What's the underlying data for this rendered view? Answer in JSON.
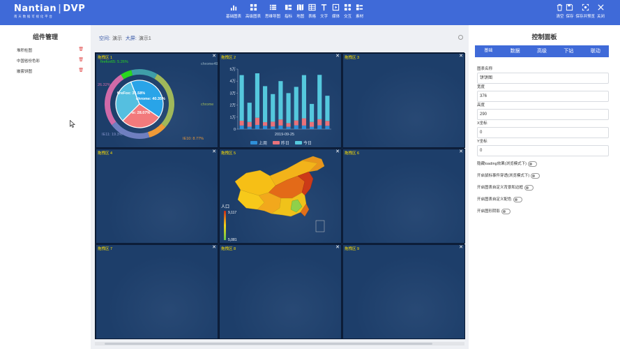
{
  "app": {
    "logo_main": "Nantian",
    "logo_sep": "|",
    "logo_product": "DVP",
    "logo_sub": "南天数据可视化平台"
  },
  "toolbar": {
    "items": [
      {
        "label": "基础图表",
        "icon": "bar-chart-icon"
      },
      {
        "label": "高级图表",
        "icon": "grid-chart-icon"
      },
      {
        "label": "思维导图",
        "icon": "list-icon"
      },
      {
        "label": "指标",
        "icon": "indicator-icon"
      },
      {
        "label": "地图",
        "icon": "map-icon"
      },
      {
        "label": "表格",
        "icon": "table-icon"
      },
      {
        "label": "文字",
        "icon": "text-icon"
      },
      {
        "label": "媒体",
        "icon": "media-icon"
      },
      {
        "label": "交互",
        "icon": "interaction-icon"
      },
      {
        "label": "素材",
        "icon": "material-icon"
      }
    ],
    "right": [
      {
        "label": "清空",
        "icon": "trash-icon"
      },
      {
        "label": "保存",
        "icon": "save-icon"
      },
      {
        "label": "保存并预览",
        "icon": "preview-icon"
      },
      {
        "label": "关闭",
        "icon": "close-icon"
      }
    ]
  },
  "left": {
    "title": "组件管理",
    "items": [
      {
        "label": "堆积柱图"
      },
      {
        "label": "中国省份色彩"
      },
      {
        "label": "嵌套饼图"
      }
    ]
  },
  "breadcrumb": {
    "space_label": "空间:",
    "space_value": "演示",
    "screen_label": "大屏:",
    "screen_value": "演示1"
  },
  "cells": [
    {
      "label": "拖拽区 1"
    },
    {
      "label": "拖拽区 2"
    },
    {
      "label": "拖拽区 3"
    },
    {
      "label": "拖拽区 4"
    },
    {
      "label": "拖拽区 5"
    },
    {
      "label": "拖拽区 6"
    },
    {
      "label": "拖拽区 7"
    },
    {
      "label": "拖拽区 8"
    },
    {
      "label": "拖拽区 9"
    }
  ],
  "close_glyph": "✕",
  "pie": {
    "inner": [
      {
        "label": "fireFox: 31.58%",
        "value": 31.58,
        "color": "#55bfe0"
      },
      {
        "label": "chrome: 40.35%",
        "value": 40.35,
        "color": "#29a4e8"
      },
      {
        "label": "ie: 28.07%",
        "value": 28.07,
        "color": "#f27a7c"
      }
    ],
    "outer": [
      {
        "label": "firefox65: 5.26%",
        "value": 5.26,
        "color": "#29d61f"
      },
      {
        "label": "chrome49: 12.28%",
        "value": 12.28,
        "color": "#3f9ea8"
      },
      {
        "label": "chrome",
        "value": 28.07,
        "color": "#a0b85a"
      },
      {
        "label": "IE10: 8.77%",
        "value": 8.77,
        "color": "#ef9a37"
      },
      {
        "label": "IE11: 19.3%",
        "value": 19.3,
        "color": "#6f7fc0"
      },
      {
        "label": "26.32%",
        "value": 26.32,
        "color": "#d06aa8"
      }
    ],
    "colors": {
      "inner_stroke": "#ffffff"
    }
  },
  "chart_data": {
    "type": "bar",
    "title": "",
    "xlabel": "2019-09-25",
    "ylabel": "",
    "ylim": [
      0,
      50000
    ],
    "y_ticks": [
      "0",
      "1万",
      "2万",
      "3万",
      "4万",
      "5万"
    ],
    "categories": [
      "1",
      "2",
      "3",
      "4",
      "5",
      "6",
      "7",
      "8",
      "9",
      "10",
      "11",
      "12"
    ],
    "stacked": true,
    "series": [
      {
        "name": "上周",
        "color": "#2f8fd8",
        "values": [
          3000,
          2000,
          3500,
          2800,
          2200,
          3000,
          2000,
          3200,
          3000,
          2000,
          3200,
          2800
        ]
      },
      {
        "name": "昨日",
        "color": "#e9727a",
        "values": [
          4000,
          4000,
          6000,
          3000,
          4000,
          5000,
          3000,
          4000,
          6000,
          4000,
          5000,
          4000
        ]
      },
      {
        "name": "今日",
        "color": "#55c8dd",
        "values": [
          38000,
          16000,
          37000,
          30000,
          23000,
          32000,
          25000,
          28000,
          36000,
          15000,
          37000,
          21000
        ]
      }
    ]
  },
  "map": {
    "legend_title": "人口",
    "max": "9,117",
    "min": "5,081"
  },
  "right": {
    "title": "控制面板",
    "tabs": [
      "基础",
      "数据",
      "高级",
      "下钻",
      "联动"
    ],
    "fields": [
      {
        "label": "图表名称",
        "value": "饼饼图"
      },
      {
        "label": "宽度",
        "value": "376"
      },
      {
        "label": "高度",
        "value": "290"
      },
      {
        "label": "X坐标",
        "value": "0"
      },
      {
        "label": "Y坐标",
        "value": "0"
      }
    ],
    "toggles": [
      {
        "label": "隐藏loading效果(浏览模式下)"
      },
      {
        "label": "开启鼠标事件穿透(浏览模式下)"
      },
      {
        "label": "开启图表自定义背景和边框"
      },
      {
        "label": "开启图表自定义配色"
      },
      {
        "label": "开启图形阴影"
      }
    ]
  }
}
